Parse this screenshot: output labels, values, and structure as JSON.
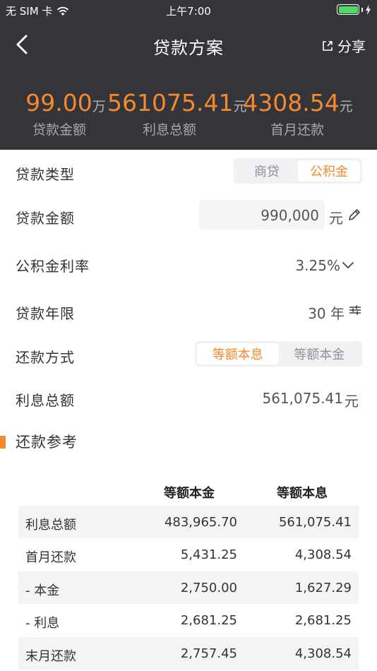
{
  "status_bar": {
    "carrier": "无 SIM 卡",
    "time": "上午7:00"
  },
  "nav": {
    "title": "贷款方案",
    "share_label": "分享"
  },
  "summary": [
    {
      "value": "99.00",
      "unit": "万",
      "label": "贷款金额"
    },
    {
      "value": "561075.41",
      "unit": "元",
      "label": "利息总额"
    },
    {
      "value": "4308.54",
      "unit": "元",
      "label": "首月还款"
    }
  ],
  "form": {
    "loan_type": {
      "label": "贷款类型",
      "options": [
        "商贷",
        "公积金"
      ],
      "selected": "公积金"
    },
    "loan_amount": {
      "label": "贷款金额",
      "value": "990,000",
      "unit": "元"
    },
    "rate": {
      "label": "公积金利率",
      "value": "3.25%"
    },
    "term": {
      "label": "贷款年限",
      "value": "30 年"
    },
    "repay_method": {
      "label": "还款方式",
      "options": [
        "等额本息",
        "等额本金"
      ],
      "selected": "等额本息"
    },
    "total_interest": {
      "label": "利息总额",
      "value": "561,075.41",
      "unit": "元"
    }
  },
  "reference": {
    "title": "还款参考",
    "columns": [
      "等额本金",
      "等额本息"
    ],
    "rows": [
      {
        "label": "利息总额",
        "a": "483,965.70",
        "b": "561,075.41"
      },
      {
        "label": "首月还款",
        "a": "5,431.25",
        "b": "4,308.54"
      },
      {
        "label": "- 本金",
        "a": "2,750.00",
        "b": "1,627.29"
      },
      {
        "label": "- 利息",
        "a": "2,681.25",
        "b": "2,681.25"
      },
      {
        "label": "末月还款",
        "a": "2,757.45",
        "b": "4,308.54"
      }
    ]
  },
  "colors": {
    "header_bg": "#33353b",
    "accent": "#f6892b",
    "battery": "#4cd964"
  }
}
